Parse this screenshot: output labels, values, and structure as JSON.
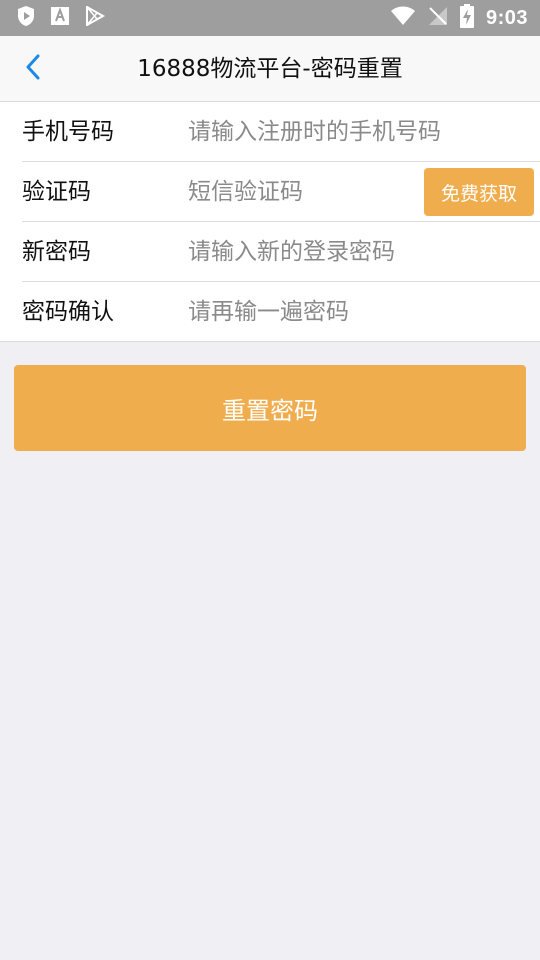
{
  "status_bar": {
    "time": "9:03",
    "icons": [
      "shield-play-icon",
      "font-a-icon",
      "play-store-icon",
      "wifi-icon",
      "no-signal-icon",
      "battery-charging-icon"
    ]
  },
  "nav": {
    "back_icon": "chevron-left-icon",
    "title": "16888物流平台-密码重置"
  },
  "form": {
    "phone": {
      "label": "手机号码",
      "placeholder": "请输入注册时的手机号码",
      "value": ""
    },
    "code": {
      "label": "验证码",
      "placeholder": "短信验证码",
      "value": "",
      "button": "免费获取"
    },
    "new_password": {
      "label": "新密码",
      "placeholder": "请输入新的登录密码",
      "value": ""
    },
    "confirm_password": {
      "label": "密码确认",
      "placeholder": "请再输一遍密码",
      "value": ""
    }
  },
  "submit_label": "重置密码",
  "colors": {
    "accent": "#f0ad4e",
    "back_arrow": "#1e88e5",
    "status_bar": "#9e9e9e",
    "background": "#efeff4"
  }
}
